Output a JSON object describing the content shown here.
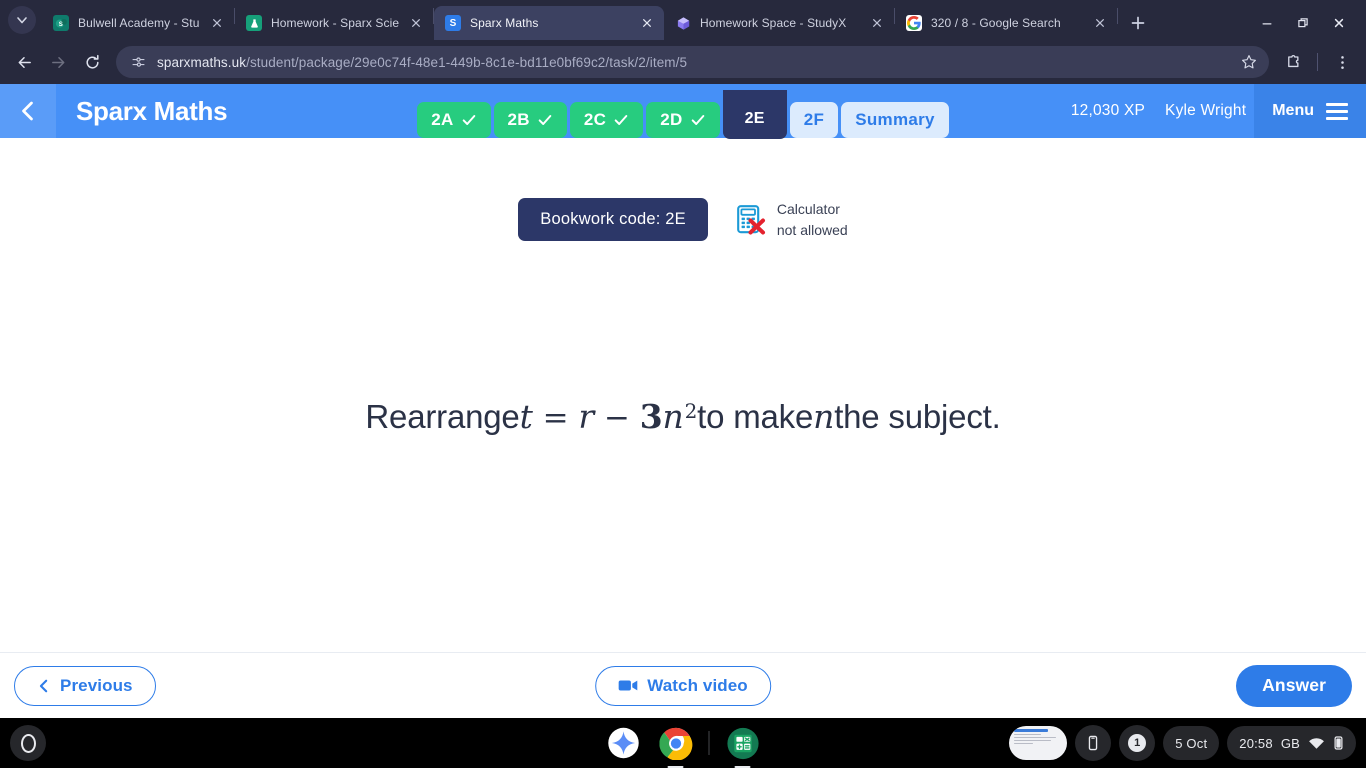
{
  "browser": {
    "tabs": [
      {
        "title": "Bulwell Academy - Student Ho",
        "favicon": "sharepoint-icon",
        "active": false
      },
      {
        "title": "Homework - Sparx Science",
        "favicon": "sparx-science-icon",
        "active": false
      },
      {
        "title": "Sparx Maths",
        "favicon": "sparx-maths-icon",
        "active": true
      },
      {
        "title": "Homework Space - StudyX",
        "favicon": "studyx-icon",
        "active": false
      },
      {
        "title": "320 / 8 - Google Search",
        "favicon": "google-icon",
        "active": false
      }
    ],
    "new_tab_label": "+",
    "url_prefix": "sparxmaths.uk",
    "url_path": "/student/package/29e0c74f-48e1-449b-8c1e-bd11e0bf69c2/task/2/item/5",
    "url_full": "sparxmaths.uk/student/package/29e0c74f-48e1-449b-8c1e-bd11e0bf69c2/task/2/item/5",
    "theme_color": "#27293d"
  },
  "sparx": {
    "brand": "Sparx Maths",
    "xp": "12,030 XP",
    "user": "Kyle Wright",
    "menu_label": "Menu",
    "header_color": "#4690f7",
    "accent_blue": "#2e7ce8",
    "done_green": "#27cc7f",
    "navy": "#2c3768",
    "task_tabs": [
      {
        "label": "2A",
        "state": "done"
      },
      {
        "label": "2B",
        "state": "done"
      },
      {
        "label": "2C",
        "state": "done"
      },
      {
        "label": "2D",
        "state": "done"
      },
      {
        "label": "2E",
        "state": "current"
      },
      {
        "label": "2F",
        "state": "todo"
      },
      {
        "label": "Summary",
        "state": "todo"
      }
    ],
    "bookwork_code": "Bookwork code: 2E",
    "calculator_line1": "Calculator",
    "calculator_line2": "not allowed",
    "question": {
      "lead": "Rearrange ",
      "var_t": "t",
      "equals": "=",
      "var_r": "r",
      "minus": "−",
      "coeff": "3",
      "var_n": "n",
      "exponent": "2",
      "mid": " to make ",
      "subject": "n",
      "tail": " the subject.",
      "plain": "Rearrange t = r − 3n² to make n the subject."
    },
    "previous_label": "Previous",
    "watch_video_label": "Watch video",
    "answer_label": "Answer"
  },
  "shelf": {
    "apps": [
      {
        "name": "gemini-app",
        "label": "Gemini"
      },
      {
        "name": "chrome-app",
        "label": "Google Chrome"
      },
      {
        "name": "calculator-app",
        "label": "Calculator"
      }
    ],
    "tray": {
      "notification_count": "1",
      "date": "5 Oct",
      "time": "20:58",
      "locale": "GB"
    }
  }
}
